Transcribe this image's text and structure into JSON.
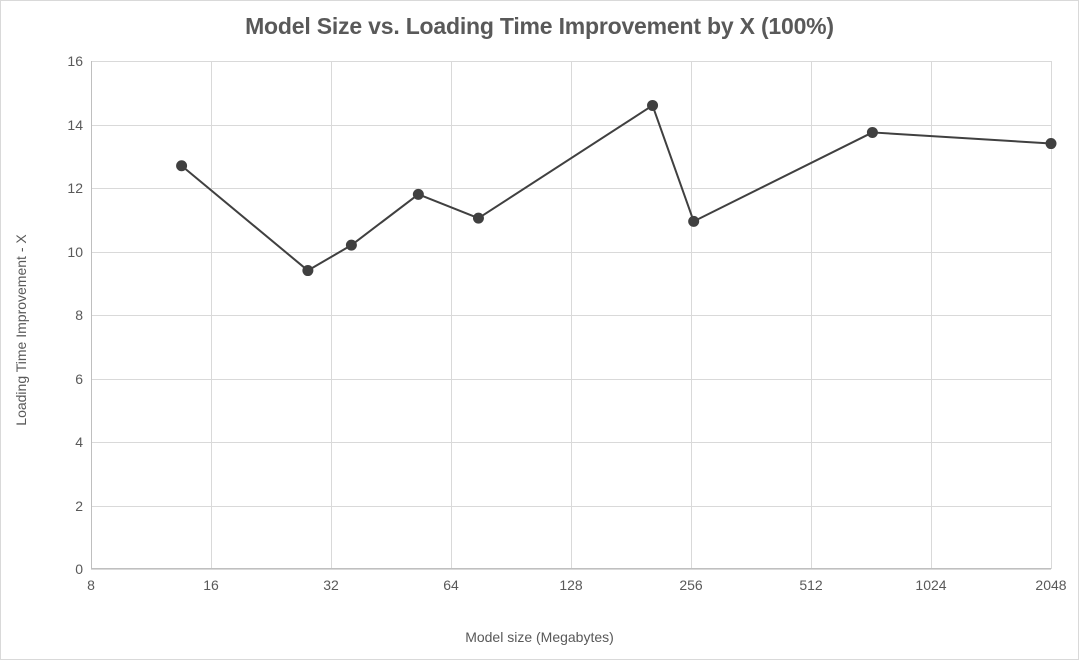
{
  "chart_data": {
    "type": "line",
    "title": "Model Size vs. Loading Time Improvement by X (100%)",
    "xlabel": "Model size (Megabytes)",
    "ylabel": "Loading Time Improvement - X",
    "x_ticks": [
      8,
      16,
      32,
      64,
      128,
      256,
      512,
      1024,
      2048
    ],
    "x_scale": "log2",
    "y_ticks": [
      0,
      2,
      4,
      6,
      8,
      10,
      12,
      14,
      16
    ],
    "ylim": [
      0,
      16
    ],
    "xlim": [
      8,
      2048
    ],
    "series": [
      {
        "name": "Loading Time Improvement - X",
        "points": [
          {
            "x": 13.5,
            "y": 12.7
          },
          {
            "x": 28,
            "y": 9.4
          },
          {
            "x": 36,
            "y": 10.2
          },
          {
            "x": 53,
            "y": 11.8
          },
          {
            "x": 75,
            "y": 11.05
          },
          {
            "x": 205,
            "y": 14.6
          },
          {
            "x": 260,
            "y": 10.95
          },
          {
            "x": 730,
            "y": 13.75
          },
          {
            "x": 2048,
            "y": 13.4
          }
        ]
      }
    ]
  }
}
